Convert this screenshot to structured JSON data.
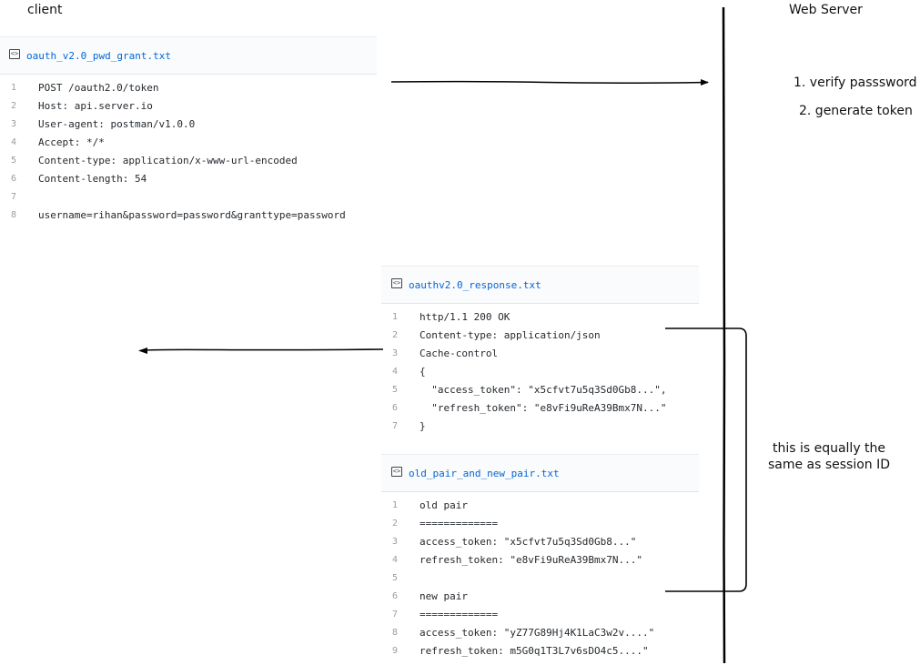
{
  "labels": {
    "client": "client",
    "server": "Web Server",
    "step1": "1. verify passsword",
    "step2": "2. generate token",
    "note": "this is equally the same as session ID"
  },
  "request_file": {
    "filename": "oauth_v2.0_pwd_grant.txt",
    "lines": [
      {
        "n": "1",
        "text": "POST /oauth2.0/token"
      },
      {
        "n": "2",
        "text": "Host: api.server.io"
      },
      {
        "n": "3",
        "text": "User-agent: postman/v1.0.0"
      },
      {
        "n": "4",
        "text": "Accept: */*"
      },
      {
        "n": "5",
        "text": "Content-type: application/x-www-url-encoded"
      },
      {
        "n": "6",
        "text": "Content-length: 54"
      },
      {
        "n": "7",
        "text": ""
      },
      {
        "n": "8",
        "text": "username=rihan&password=password&granttype=password"
      }
    ]
  },
  "response_file": {
    "filename": "oauthv2.0_response.txt",
    "lines": [
      {
        "n": "1",
        "text": "http/1.1 200 OK"
      },
      {
        "n": "2",
        "text": "Content-type: application/json"
      },
      {
        "n": "3",
        "text": "Cache-control"
      },
      {
        "n": "4",
        "text": "{"
      },
      {
        "n": "5",
        "text": "  \"access_token\": \"x5cfvt7u5q3Sd0Gb8...\","
      },
      {
        "n": "6",
        "text": "  \"refresh_token\": \"e8vFi9uReA39Bmx7N...\""
      },
      {
        "n": "7",
        "text": "}"
      }
    ]
  },
  "pair_file": {
    "filename": "old_pair_and_new_pair.txt",
    "lines": [
      {
        "n": "1",
        "text": "old pair"
      },
      {
        "n": "2",
        "text": "============="
      },
      {
        "n": "3",
        "text": "access_token: \"x5cfvt7u5q3Sd0Gb8...\""
      },
      {
        "n": "4",
        "text": "refresh_token: \"e8vFi9uReA39Bmx7N...\""
      },
      {
        "n": "5",
        "text": ""
      },
      {
        "n": "6",
        "text": "new pair"
      },
      {
        "n": "7",
        "text": "============="
      },
      {
        "n": "8",
        "text": "access_token: \"yZ77G89Hj4K1LaC3w2v....\""
      },
      {
        "n": "9",
        "text": "refresh_token: m5G0q1T3L7v6sDO4c5....\""
      }
    ]
  }
}
